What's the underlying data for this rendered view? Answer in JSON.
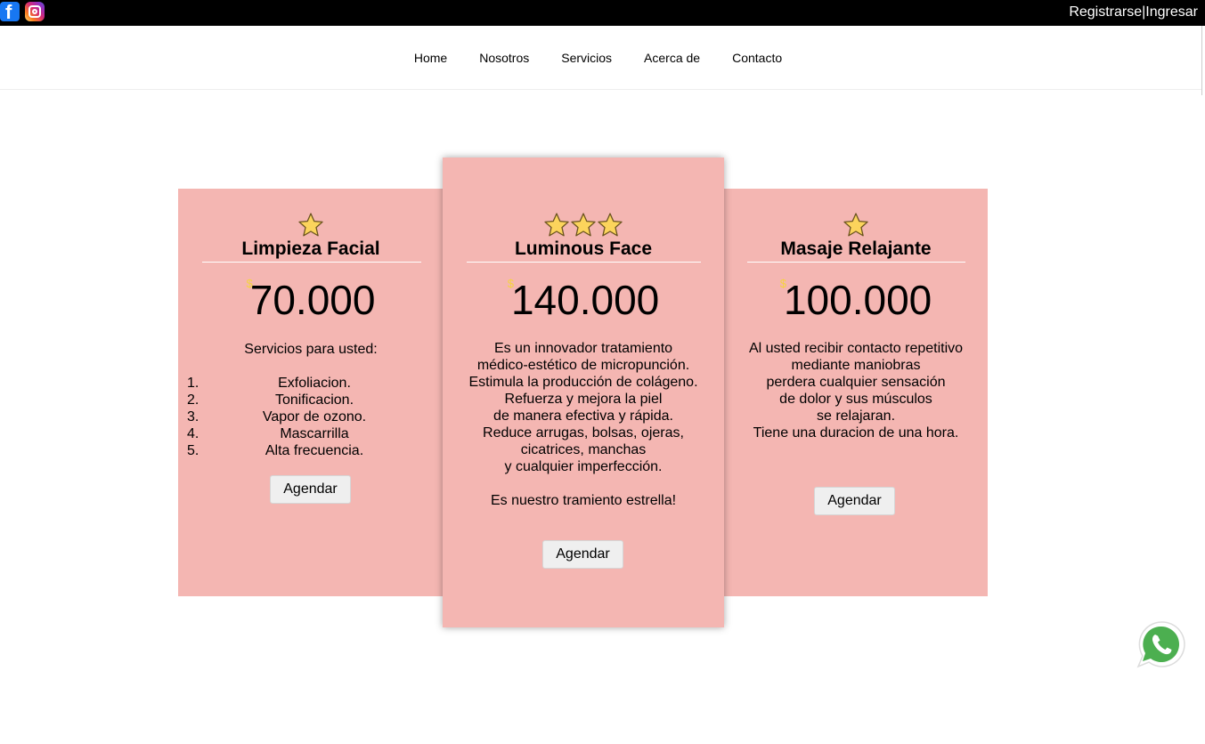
{
  "topbar": {
    "social": [
      {
        "icon": "facebook-icon",
        "color": "#1877f2"
      },
      {
        "icon": "instagram-icon",
        "color": "#d62976"
      }
    ],
    "register_label": "Registrarse",
    "separator": "|",
    "login_label": "Ingresar"
  },
  "nav": {
    "items": [
      {
        "label": "Home"
      },
      {
        "label": "Nosotros"
      },
      {
        "label": "Servicios"
      },
      {
        "label": "Acerca de"
      },
      {
        "label": "Contacto"
      }
    ]
  },
  "cards": [
    {
      "stars": 1,
      "title": "Limpieza Facial",
      "currency": "$",
      "price": "70.000",
      "intro": "Servicios para usted:",
      "list": [
        {
          "num": "1.",
          "text": "Exfoliacion."
        },
        {
          "num": "2.",
          "text": "Tonificacion."
        },
        {
          "num": "3.",
          "text": "Vapor de ozono."
        },
        {
          "num": "4.",
          "text": "Mascarrilla"
        },
        {
          "num": "5.",
          "text": "Alta frecuencia."
        }
      ],
      "button": "Agendar"
    },
    {
      "stars": 3,
      "title": "Luminous Face",
      "currency": "$",
      "price": "140.000",
      "lines": [
        "Es un innovador tratamiento",
        "médico-estético de micropunción.",
        "Estimula la producción de colágeno.",
        "Refuerza y mejora la piel",
        "de manera efectiva y rápida.",
        "Reduce arrugas, bolsas, ojeras,",
        "cicatrices, manchas",
        "y cualquier imperfección.",
        "",
        "Es nuestro tramiento estrella!"
      ],
      "button": "Agendar"
    },
    {
      "stars": 1,
      "title": "Masaje Relajante",
      "currency": "$",
      "price": "100.000",
      "lines": [
        "Al usted recibir contacto repetitivo",
        "mediante maniobras",
        "perdera cualquier sensación",
        "de dolor y sus músculos",
        "se relajaran.",
        "Tiene una duracion de una hora."
      ],
      "button": "Agendar"
    }
  ],
  "colors": {
    "card_background": "#f4b6b2",
    "currency": "#f5d43e",
    "star_fill": "#fcd45c",
    "whatsapp": "#4caf50"
  },
  "floating": {
    "icon": "whatsapp-icon"
  }
}
